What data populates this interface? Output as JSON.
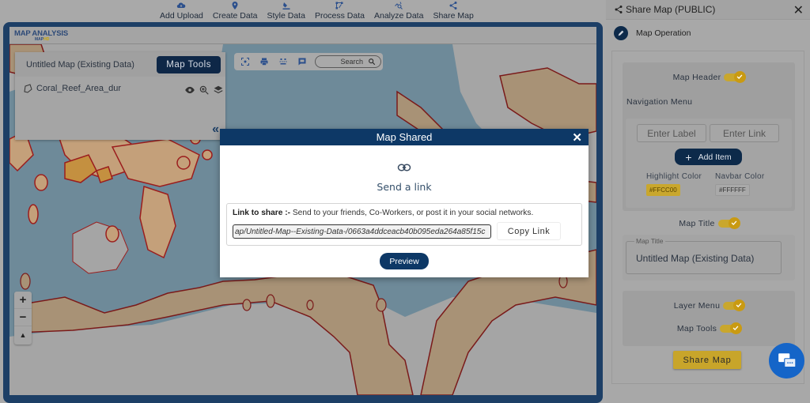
{
  "top_nav": {
    "items": [
      {
        "label": "Add Upload",
        "icon": "cloud-upload-icon"
      },
      {
        "label": "Create Data",
        "icon": "map-pin-icon"
      },
      {
        "label": "Style Data",
        "icon": "paint-bucket-icon"
      },
      {
        "label": "Process Data",
        "icon": "process-icon"
      },
      {
        "label": "Analyze Data",
        "icon": "analyze-icon"
      },
      {
        "label": "Share Map",
        "icon": "share-icon"
      }
    ]
  },
  "map": {
    "logo_main": "MAP ANALYSIS",
    "logo_sub_a": "MAP",
    "logo_sub_b": "HD",
    "layer_panel": {
      "map_name": "Untitled Map (Existing Data)",
      "map_tools_label": "Map Tools",
      "layers": [
        {
          "name": "Coral_Reef_Area_dur"
        }
      ],
      "collapse_label": "«"
    },
    "toolbar": {
      "search_label": "Search"
    },
    "zoom": {
      "in_label": "+",
      "out_label": "−",
      "north_label": "▲"
    },
    "colors": {
      "ocean": "#6e8a99",
      "land": "#a5a5a5",
      "reef_fill": "#a89276",
      "reef_stroke": "#9b1d1d"
    }
  },
  "modal": {
    "title": "Map Shared",
    "close_label": "✕",
    "send_link_label": "Send a link",
    "share_label_bold": "Link to share :-",
    "share_label_text": " Send to your friends, Co-Workers, or post it in your social networks.",
    "link_value": "ap/Untitled-Map--Existing-Data-/0663a4ddceacb40b095eda264a85f15c",
    "copy_label": "Copy Link",
    "preview_label": "Preview"
  },
  "side_panel": {
    "title": "Share Map (PUBLIC)",
    "close_label": "✕",
    "operation_label": "Map Operation",
    "map_header_label": "Map Header",
    "map_header_on": true,
    "navigation_menu_label": "Navigation Menu",
    "enter_label_placeholder": "Enter Label",
    "enter_link_placeholder": "Enter Link",
    "add_item_label": "Add Item",
    "highlight_color_label": "Highlight Color",
    "highlight_color_value": "#FFCC00",
    "navbar_color_label": "Navbar Color",
    "navbar_color_value": "#FFFFFF",
    "map_title_toggle_label": "Map Title",
    "map_title_on": true,
    "map_title_field_legend": "Map Title",
    "map_title_field_value": "Untitled Map (Existing Data)",
    "layer_menu_label": "Layer Menu",
    "layer_menu_on": true,
    "map_tools_label": "Map Tools",
    "map_tools_on": true,
    "share_button_label": "Share Map"
  },
  "chat_widget": {
    "icon": "chat-icon"
  }
}
